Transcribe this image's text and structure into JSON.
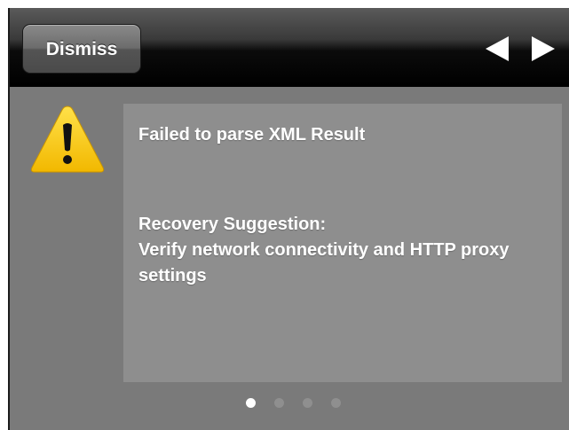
{
  "toolbar": {
    "dismiss_label": "Dismiss",
    "prev_icon": "triangle-left-icon",
    "next_icon": "triangle-right-icon"
  },
  "alert": {
    "icon": "warning-icon",
    "title": "Failed to parse XML Result",
    "recovery_label": "Recovery Suggestion:",
    "recovery_text": "Verify network connectivity and HTTP proxy settings"
  },
  "pagination": {
    "total_pages": 4,
    "current_page": 1
  },
  "colors": {
    "background": "#7a7a7a",
    "panel": "#8e8e8e",
    "toolbar": "#000000",
    "warning_yellow": "#f5c400",
    "text": "#ffffff"
  }
}
